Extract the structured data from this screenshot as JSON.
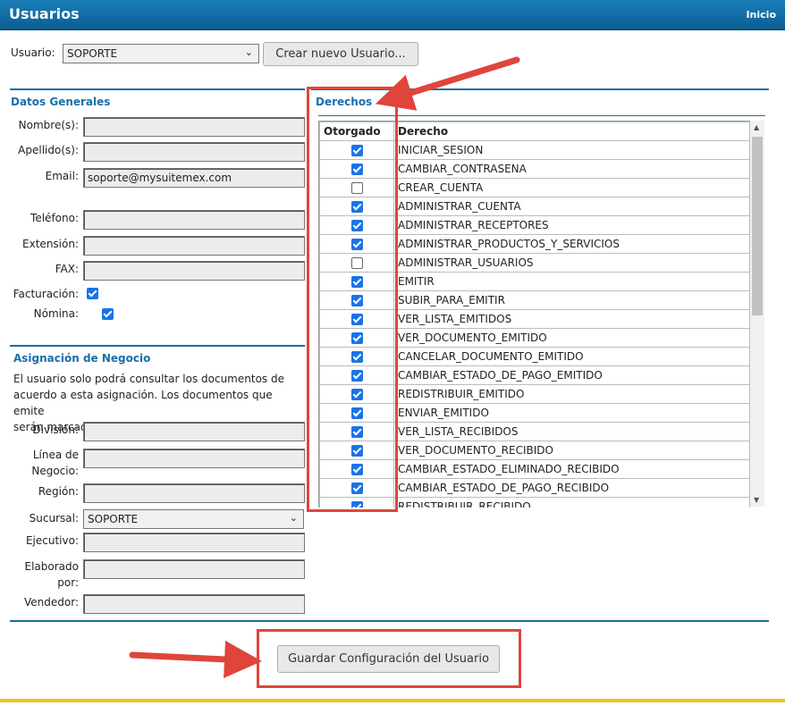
{
  "header": {
    "title": "Usuarios",
    "home_link": "Inicio"
  },
  "user_select": {
    "label": "Usuario:",
    "value": "SOPORTE",
    "create_button": "Crear nuevo Usuario..."
  },
  "general": {
    "title": "Datos Generales",
    "fields": {
      "nombre": {
        "label": "Nombre(s):",
        "value": ""
      },
      "apellido": {
        "label": "Apellido(s):",
        "value": ""
      },
      "email": {
        "label": "Email:",
        "value": "soporte@mysuitemex.com"
      },
      "telefono": {
        "label": "Teléfono:",
        "value": ""
      },
      "extension": {
        "label": "Extensión:",
        "value": ""
      },
      "fax": {
        "label": "FAX:",
        "value": ""
      }
    },
    "facturacion": {
      "label": "Facturación:",
      "checked": true
    },
    "nomina": {
      "label": "Nómina:",
      "checked": true
    }
  },
  "business": {
    "title": "Asignación de Negocio",
    "description_lines": [
      "El usuario solo podrá consultar los documentos de",
      "acuerdo a esta asignación. Los documentos que emite",
      "serán marcados con la misma."
    ],
    "division": {
      "label": "División:",
      "value": ""
    },
    "linea_line1": "Línea de",
    "linea_line2": "Negocio:",
    "region": {
      "label": "Región:",
      "value": ""
    },
    "sucursal": {
      "label": "Sucursal:",
      "value": "SOPORTE"
    },
    "ejecutivo": {
      "label": "Ejecutivo:",
      "value": ""
    },
    "elaborado_line1": "Elaborado",
    "elaborado_line2": "por:",
    "vendedor": {
      "label": "Vendedor:",
      "value": ""
    }
  },
  "rights": {
    "title": "Derechos",
    "col_granted": "Otorgado",
    "col_right": "Derecho",
    "rows": [
      {
        "name": "INICIAR_SESION",
        "granted": true
      },
      {
        "name": "CAMBIAR_CONTRASENA",
        "granted": true
      },
      {
        "name": "CREAR_CUENTA",
        "granted": false
      },
      {
        "name": "ADMINISTRAR_CUENTA",
        "granted": true
      },
      {
        "name": "ADMINISTRAR_RECEPTORES",
        "granted": true
      },
      {
        "name": "ADMINISTRAR_PRODUCTOS_Y_SERVICIOS",
        "granted": true
      },
      {
        "name": "ADMINISTRAR_USUARIOS",
        "granted": false
      },
      {
        "name": "EMITIR",
        "granted": true
      },
      {
        "name": "SUBIR_PARA_EMITIR",
        "granted": true
      },
      {
        "name": "VER_LISTA_EMITIDOS",
        "granted": true
      },
      {
        "name": "VER_DOCUMENTO_EMITIDO",
        "granted": true
      },
      {
        "name": "CANCELAR_DOCUMENTO_EMITIDO",
        "granted": true
      },
      {
        "name": "CAMBIAR_ESTADO_DE_PAGO_EMITIDO",
        "granted": true
      },
      {
        "name": "REDISTRIBUIR_EMITIDO",
        "granted": true
      },
      {
        "name": "ENVIAR_EMITIDO",
        "granted": true
      },
      {
        "name": "VER_LISTA_RECIBIDOS",
        "granted": true
      },
      {
        "name": "VER_DOCUMENTO_RECIBIDO",
        "granted": true
      },
      {
        "name": "CAMBIAR_ESTADO_ELIMINADO_RECIBIDO",
        "granted": true
      },
      {
        "name": "CAMBIAR_ESTADO_DE_PAGO_RECIBIDO",
        "granted": true
      },
      {
        "name": "REDISTRIBUIR_RECIBIDO",
        "granted": true
      }
    ]
  },
  "save_button": "Guardar Configuración del Usuario",
  "colors": {
    "header_blue": "#0a5f94",
    "section_blue": "#1b6ea8",
    "annotation_red": "#e0453b",
    "footer_yellow": "#f0c419",
    "checkbox_blue": "#1a73e8"
  }
}
